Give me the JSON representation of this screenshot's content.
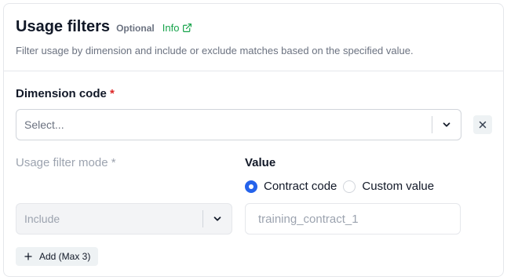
{
  "header": {
    "title": "Usage filters",
    "optional": "Optional",
    "info": "Info",
    "description": "Filter usage by dimension and include or exclude matches based on the specified value."
  },
  "dimension": {
    "label": "Dimension code",
    "required_mark": "*",
    "placeholder": "Select..."
  },
  "mode": {
    "label": "Usage filter mode",
    "required_mark": "*",
    "value": "Include"
  },
  "value": {
    "label": "Value",
    "options": [
      {
        "label": "Contract code",
        "checked": true
      },
      {
        "label": "Custom value",
        "checked": false
      }
    ],
    "placeholder": "training_contract_1"
  },
  "add_button": {
    "label": "Add (Max 3)"
  },
  "icons": {
    "info": "external-link-icon",
    "dropdown": "chevron-down-icon",
    "remove": "close-icon",
    "add": "plus-icon"
  },
  "colors": {
    "link": "#16a34a",
    "required": "#dc2626",
    "radio_checked": "#2563eb"
  }
}
